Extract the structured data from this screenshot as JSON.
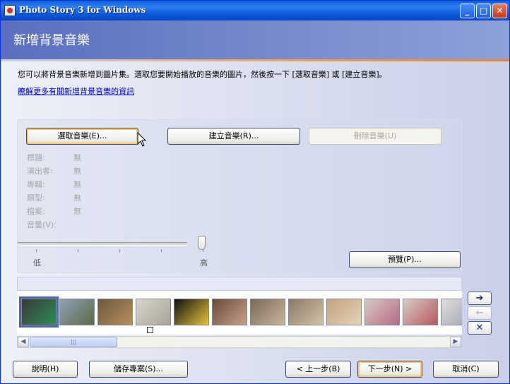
{
  "window": {
    "title": "Photo Story 3 for Windows"
  },
  "header": {
    "title": "新增背景音樂"
  },
  "instructions": {
    "text": "您可以將背景音樂新增到圖片集。選取您要開始播放的音樂的圖片，然後按一下 [選取音樂] 或 [建立音樂]。",
    "link": "瞭解更多有關新增背景音樂的資訊"
  },
  "music_buttons": {
    "select": "選取音樂(E)...",
    "create": "建立音樂(R)...",
    "delete": "刪除音樂(U)"
  },
  "info": {
    "rows": [
      {
        "label": "標題:",
        "value": "無"
      },
      {
        "label": "演出者:",
        "value": "無"
      },
      {
        "label": "專輯:",
        "value": "無"
      },
      {
        "label": "類型:",
        "value": "無"
      },
      {
        "label": "檔案:",
        "value": "無"
      }
    ],
    "volume_label": "音量(V):"
  },
  "volume": {
    "low": "低",
    "high": "高",
    "level": 1.0
  },
  "preview_button": "預覽(P)...",
  "filmstrip": {
    "selected_index": 0,
    "thumbnails": [
      {
        "colors": [
          "#3a3a3a",
          "#2e8b57"
        ]
      },
      {
        "colors": [
          "#8fa0b5",
          "#5b6b4a"
        ]
      },
      {
        "colors": [
          "#6a5a3e",
          "#b98d5c"
        ]
      },
      {
        "colors": [
          "#d9d4c9",
          "#a8a49a"
        ]
      },
      {
        "colors": [
          "#111111",
          "#e5c33b"
        ]
      },
      {
        "colors": [
          "#6a4c3c",
          "#c7a08a"
        ]
      },
      {
        "colors": [
          "#7b6a55",
          "#c5b6a0"
        ]
      },
      {
        "colors": [
          "#8a7a66",
          "#d4c2a8"
        ]
      },
      {
        "colors": [
          "#c5a37c",
          "#e3d2bb"
        ]
      },
      {
        "colors": [
          "#d8c8c0",
          "#b56a86"
        ]
      },
      {
        "colors": [
          "#d8ccc8",
          "#b6585c"
        ]
      },
      {
        "colors": [
          "#e0dcd8",
          "#9ca2b5"
        ]
      }
    ]
  },
  "side_buttons": {
    "next": "➔",
    "prev": "←",
    "delete": "✕"
  },
  "bottom": {
    "help": "說明(H)",
    "save": "儲存專案(S)...",
    "back": "< 上一步(B)",
    "next": "下一步(N) >",
    "cancel": "取消(C)"
  }
}
